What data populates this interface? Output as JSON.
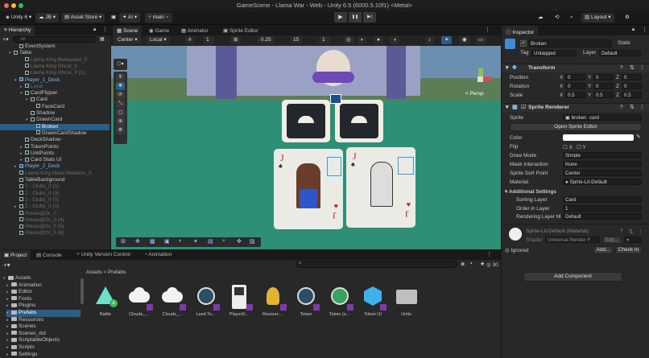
{
  "window": {
    "title": "GameScene - Llama War - Web - Unity 6.5 (6000.5.10f1) <Metal>"
  },
  "toolbar": {
    "unity_version": "Unity 6",
    "account": "JB",
    "asset_store": "Asset Store",
    "ai": "AI",
    "branch": "main",
    "layout": "Layout",
    "play": "▶",
    "pause": "❚❚",
    "step": "▶|"
  },
  "hierarchy": {
    "tab": "Hierarchy",
    "search_placeholder": "All",
    "items": [
      {
        "label": "EventSystem",
        "indent": 2,
        "style": "normal"
      },
      {
        "label": "Table",
        "indent": 1,
        "style": "normal",
        "arrow": "▾"
      },
      {
        "label": "Llama King Beheaded_0",
        "indent": 3,
        "style": "dim"
      },
      {
        "label": "Llama King Ghost_0",
        "indent": 3,
        "style": "dim"
      },
      {
        "label": "Llama King Ghost_0 (1)",
        "indent": 3,
        "style": "dim"
      },
      {
        "label": "Player_1_Deck",
        "indent": 2,
        "style": "blue",
        "arrow": "▾"
      },
      {
        "label": "Laval",
        "indent": 3,
        "style": "dim",
        "arrow": "▸"
      },
      {
        "label": "CardFlipper",
        "indent": 3,
        "style": "normal",
        "arrow": "▾"
      },
      {
        "label": "Card",
        "indent": 4,
        "style": "normal",
        "arrow": "▾"
      },
      {
        "label": "FaceCard",
        "indent": 5,
        "style": "normal"
      },
      {
        "label": "Shadow",
        "indent": 4,
        "style": "normal"
      },
      {
        "label": "DrawnCard",
        "indent": 4,
        "style": "normal",
        "arrow": "▾"
      },
      {
        "label": "Broken",
        "indent": 5,
        "style": "sel"
      },
      {
        "label": "DrawnCardShadow",
        "indent": 5,
        "style": "normal"
      },
      {
        "label": "DeckShadow",
        "indent": 3,
        "style": "normal"
      },
      {
        "label": "TokenPoints",
        "indent": 3,
        "style": "normal",
        "arrow": "▸"
      },
      {
        "label": "UnitPoints",
        "indent": 3,
        "style": "normal",
        "arrow": "▸"
      },
      {
        "label": "Card Stats UI",
        "indent": 3,
        "style": "normal",
        "arrow": "▸"
      },
      {
        "label": "Player_2_Deck",
        "indent": 2,
        "style": "blue",
        "arrow": "▸"
      },
      {
        "label": "Llama King Head Skeleton_0",
        "indent": 2,
        "style": "dim"
      },
      {
        "label": "TableBackground",
        "indent": 2,
        "style": "normal"
      },
      {
        "label": "2 - Clubs_0 (1)",
        "indent": 2,
        "style": "dim"
      },
      {
        "label": "2 - Clubs_0 (3)",
        "indent": 2,
        "style": "dim"
      },
      {
        "label": "2 - Clubs_0 (5)",
        "indent": 2,
        "style": "dim"
      },
      {
        "label": "2 - Clubs_0 (1)",
        "indent": 2,
        "style": "dim",
        "arrow": "▸"
      },
      {
        "label": "House@2x_0",
        "indent": 2,
        "style": "dim"
      },
      {
        "label": "House@2x_0 (4)",
        "indent": 2,
        "style": "dim"
      },
      {
        "label": "House@2x_0 (5)",
        "indent": 2,
        "style": "dim"
      },
      {
        "label": "House@2x_0 (6)",
        "indent": 2,
        "style": "dim"
      }
    ]
  },
  "scene": {
    "tabs": [
      "Scene",
      "Game",
      "Animator",
      "Sprite Editor"
    ],
    "pivot": "Center",
    "space": "Local",
    "grid_value": "1",
    "snap_value": "0.25",
    "snap_value2": "15",
    "snap_value3": "1",
    "persp": "< Persp"
  },
  "inspector": {
    "tab": "Inspector",
    "object_name": "Broken",
    "static": "Static",
    "tag_label": "Tag",
    "tag_value": "Untagged",
    "layer_label": "Layer",
    "layer_value": "Default",
    "transform": {
      "title": "Transform",
      "rows": [
        {
          "label": "Position",
          "x": "0",
          "y": "0",
          "z": "0"
        },
        {
          "label": "Rotation",
          "x": "0",
          "y": "0",
          "z": "0"
        },
        {
          "label": "Scale",
          "x": "0.5",
          "y": "0.5",
          "z": "0.5"
        }
      ]
    },
    "sprite_renderer": {
      "title": "Sprite Renderer",
      "sprite_label": "Sprite",
      "sprite_value": "broken_card",
      "open_editor": "Open Sprite Editor",
      "color_label": "Color",
      "flip_label": "Flip",
      "flip_x": "X",
      "flip_y": "Y",
      "draw_mode_label": "Draw Mode",
      "draw_mode_value": "Simple",
      "mask_label": "Mask Interaction",
      "mask_value": "None",
      "sort_point_label": "Sprite Sort Point",
      "sort_point_value": "Center",
      "material_label": "Material",
      "material_value": "Sprite-Lit-Default",
      "additional": "Additional Settings",
      "sorting_layer_label": "Sorting Layer",
      "sorting_layer_value": "Card",
      "order_label": "Order in Layer",
      "order_value": "1",
      "rendering_layer_label": "Rendering Layer M",
      "rendering_layer_value": "Default"
    },
    "material": {
      "name": "Sprite-Lit-Default (Material)",
      "shader_label": "Shader",
      "shader_value": "Universal Render F",
      "edit": "Edit...",
      "ignored": "Ignored",
      "add": "Add...",
      "check_in": "Check In"
    },
    "add_component": "Add Component"
  },
  "bottom": {
    "tabs": [
      "Project",
      "Console",
      "Unity Version Control",
      "Animation"
    ],
    "breadcrumb": [
      "Assets",
      "Prefabs"
    ],
    "count": "30",
    "tree": [
      "Assets",
      "Animation",
      "Editor",
      "Fonts",
      "Plugins",
      "Prefabs",
      "Resources",
      "Scenes",
      "Scenes_dst",
      "ScriptableObjects",
      "Scripts",
      "Settings"
    ],
    "assets": [
      {
        "label": "Battle",
        "kind": "triangle"
      },
      {
        "label": "Clouds_...",
        "kind": "cloud"
      },
      {
        "label": "Clouds_...",
        "kind": "cloud"
      },
      {
        "label": "Land To...",
        "kind": "token"
      },
      {
        "label": "PlayerD...",
        "kind": "card"
      },
      {
        "label": "Resourc...",
        "kind": "leaf"
      },
      {
        "label": "Token",
        "kind": "token"
      },
      {
        "label": "Token (s...",
        "kind": "token2"
      },
      {
        "label": "Token UI",
        "kind": "cube"
      },
      {
        "label": "Units",
        "kind": "folder"
      }
    ]
  },
  "colors": {
    "accent": "#2c5d87",
    "play_blue": "#3d8ad6",
    "table_green": "#2f8f76"
  }
}
